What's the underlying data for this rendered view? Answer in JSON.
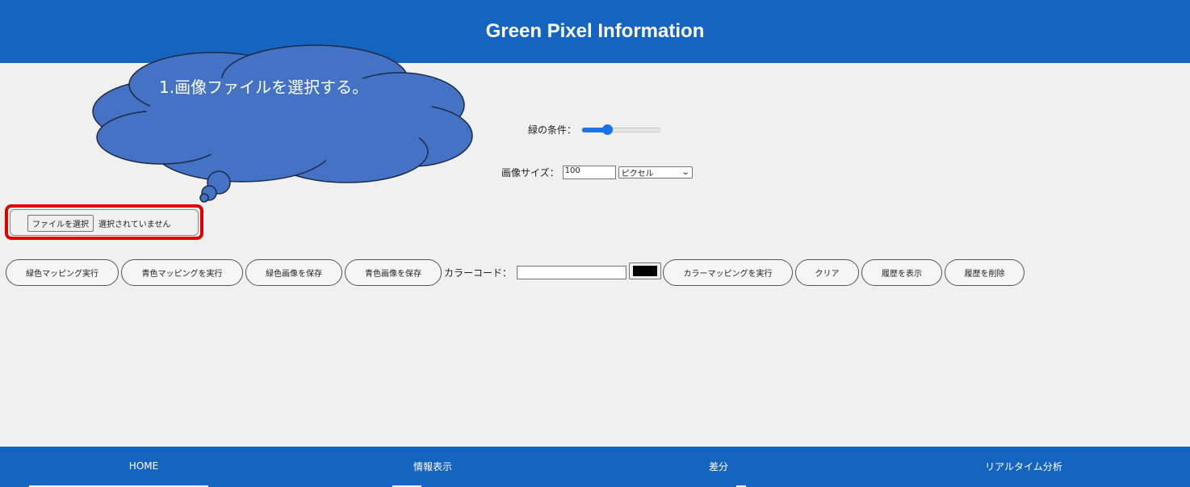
{
  "header": {
    "title": "Green Pixel Information"
  },
  "callout": {
    "text": "1.画像ファイルを選択する。"
  },
  "controls": {
    "green_condition_label": "緑の条件：",
    "green_condition_level": 0.32,
    "image_size_label": "画像サイズ：",
    "image_size_value": "100",
    "image_size_unit": "ピクセル",
    "file_button_label": "ファイルを選択",
    "file_status": "選択されていません"
  },
  "actions": {
    "green_mapping": "緑色マッピング実行",
    "blue_mapping": "青色マッピングを実行",
    "save_green": "緑色画像を保存",
    "save_blue": "青色画像を保存",
    "color_code_label": "カラーコード：",
    "color_code_value": "",
    "color_swatch": "#000000",
    "color_mapping": "カラーマッピングを実行",
    "clear": "クリア",
    "show_history": "履歴を表示",
    "delete_history": "履歴を削除"
  },
  "footer": {
    "nav": [
      {
        "label": "HOME"
      },
      {
        "label": "情報表示"
      },
      {
        "label": "差分"
      },
      {
        "label": "リアルタイム分析"
      }
    ]
  },
  "colors": {
    "primary": "#1565c0",
    "callout_fill": "#4472c4",
    "highlight_border": "#e00000",
    "slider_accent": "#1a73e8"
  }
}
